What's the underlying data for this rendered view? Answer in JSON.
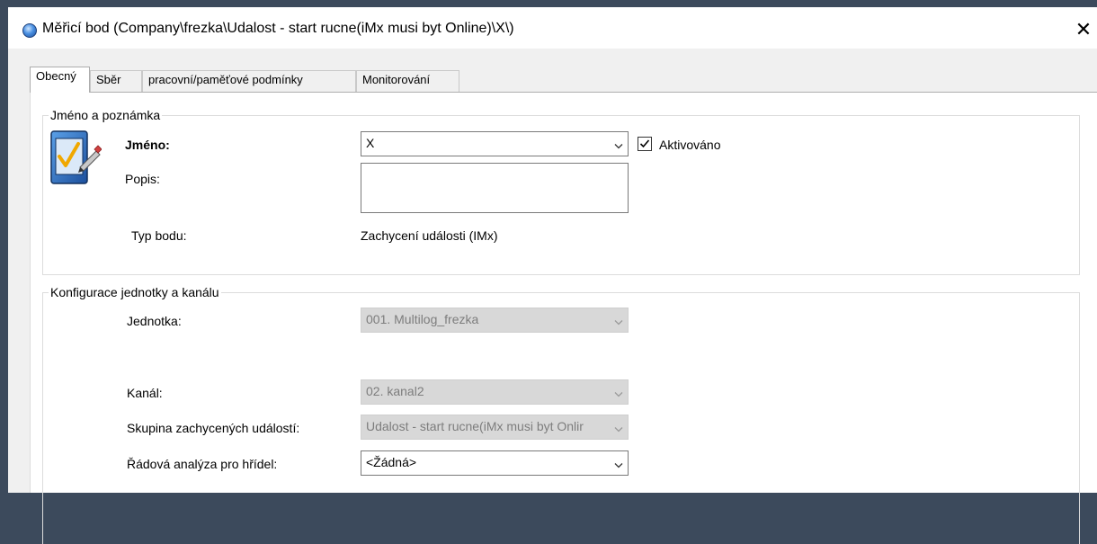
{
  "window": {
    "title": "Měřicí bod (Company\\frezka\\Udalost - start rucne(iMx musi byt Online)\\X\\)",
    "close_glyph": "✕"
  },
  "tabs": [
    {
      "label": "Obecný",
      "active": true
    },
    {
      "label": "Sběr",
      "active": false
    },
    {
      "label": "pracovní/paměťové podmínky",
      "active": false
    },
    {
      "label": "Monitorování",
      "active": false
    }
  ],
  "name_group": {
    "legend": "Jméno a poznámka",
    "icon": "measurement-point-icon",
    "name_label": "Jméno:",
    "name_value": "X",
    "active_label": "Aktivováno",
    "active_checked": true,
    "description_label": "Popis:",
    "description_value": "",
    "point_type_label": "Typ bodu:",
    "point_type_value": "Zachycení události (IMx)"
  },
  "config_group": {
    "legend": "Konfigurace jednotky a kanálu",
    "unit_label": "Jednotka:",
    "unit_value": "001. Multilog_frezka",
    "channel_label": "Kanál:",
    "channel_value": "02. kanal2",
    "event_group_label": "Skupina zachycených událostí:",
    "event_group_value": "Udalost - start rucne(iMx musi byt Onlir",
    "order_analysis_label": "Řádová analýza pro hřídel:",
    "order_analysis_value": "<Žádná>"
  },
  "colors": {
    "desktop": "#3c4a5c",
    "dialog_bg": "#f0f0f0",
    "disabled_field": "#d8d8d8",
    "check": "#000000"
  }
}
